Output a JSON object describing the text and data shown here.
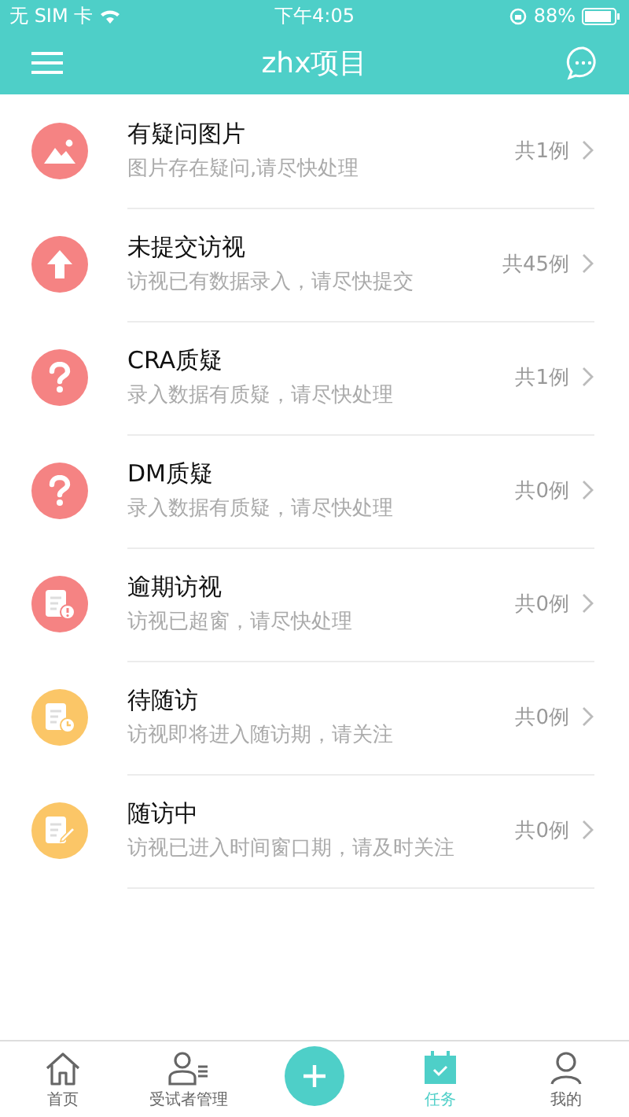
{
  "status_bar": {
    "carrier": "无 SIM 卡",
    "time": "下午4:05",
    "battery": "88%"
  },
  "nav_bar": {
    "title": "zhx项目"
  },
  "tasks": [
    {
      "kind": "picture",
      "color": "#f58383",
      "title": "有疑问图片",
      "subtitle": "图片存在疑问,请尽快处理",
      "count": "共1例"
    },
    {
      "kind": "upload",
      "color": "#f58383",
      "title": "未提交访视",
      "subtitle": "访视已有数据录入，请尽快提交",
      "count": "共45例"
    },
    {
      "kind": "question",
      "color": "#f58383",
      "title": "CRA质疑",
      "subtitle": "录入数据有质疑，请尽快处理",
      "count": "共1例"
    },
    {
      "kind": "question",
      "color": "#f58383",
      "title": "DM质疑",
      "subtitle": "录入数据有质疑，请尽快处理",
      "count": "共0例"
    },
    {
      "kind": "overdue",
      "color": "#f58383",
      "title": "逾期访视",
      "subtitle": "访视已超窗，请尽快处理",
      "count": "共0例"
    },
    {
      "kind": "pending",
      "color": "#fbc667",
      "title": "待随访",
      "subtitle": "访视即将进入随访期，请关注",
      "count": "共0例"
    },
    {
      "kind": "ongoing",
      "color": "#fbc667",
      "title": "随访中",
      "subtitle": "访视已进入时间窗口期，请及时关注",
      "count": "共0例"
    }
  ],
  "tab_bar": [
    {
      "kind": "home",
      "label": "首页",
      "selected": false
    },
    {
      "kind": "subjects",
      "label": "受试者管理",
      "selected": false
    },
    {
      "kind": "add",
      "selected": false
    },
    {
      "kind": "tasks",
      "label": "任务",
      "selected": true
    },
    {
      "kind": "me",
      "label": "我的",
      "selected": false
    }
  ]
}
